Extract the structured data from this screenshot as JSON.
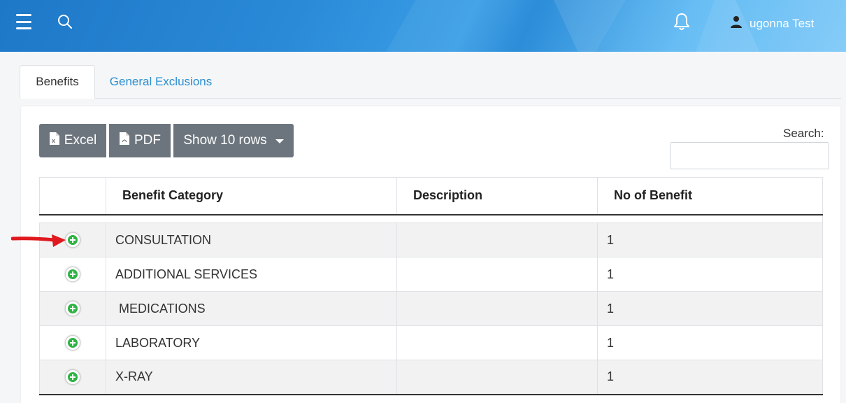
{
  "header": {
    "user_name": "ugonna Test",
    "icons": [
      "menu-icon",
      "search-icon",
      "bell-icon",
      "user-icon"
    ],
    "gradient_colors": [
      "#1e78c8",
      "#56b6f3"
    ]
  },
  "tabs": [
    {
      "label": "Benefits",
      "active": true
    },
    {
      "label": "General Exclusions",
      "active": false
    }
  ],
  "toolbar": {
    "excel_label": "Excel",
    "pdf_label": "PDF",
    "rows_label": "Show 10 rows",
    "search_label": "Search:",
    "search_value": "",
    "button_color": "#6c757d"
  },
  "table": {
    "headers": [
      "",
      "Benefit Category",
      "Description",
      "No of Benefit"
    ],
    "rows": [
      {
        "category": "CONSULTATION",
        "description": "",
        "count": "1"
      },
      {
        "category": "ADDITIONAL SERVICES",
        "description": "",
        "count": "1"
      },
      {
        "category": " MEDICATIONS",
        "description": "",
        "count": "1"
      },
      {
        "category": "LABORATORY",
        "description": "",
        "count": "1"
      },
      {
        "category": "X-RAY",
        "description": "",
        "count": "1"
      }
    ],
    "expand_icon_color": "#2fb344"
  },
  "annotation": {
    "arrow_color": "#e0191e",
    "icon": "red-arrow-icon"
  }
}
